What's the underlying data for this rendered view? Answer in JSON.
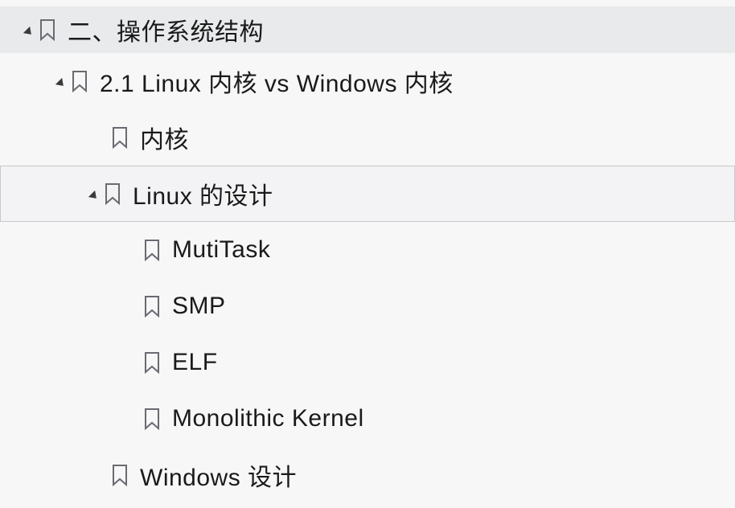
{
  "tree": {
    "lvl0": {
      "label": "二、操作系统结构"
    },
    "lvl1": {
      "label": "2.1 Linux 内核 vs Windows 内核"
    },
    "lvl2a": {
      "label": "内核"
    },
    "lvl2b": {
      "label": "Linux 的设计"
    },
    "lvl3a": {
      "label": "MutiTask"
    },
    "lvl3b": {
      "label": "SMP"
    },
    "lvl3c": {
      "label": "ELF"
    },
    "lvl3d": {
      "label": "Monolithic Kernel"
    },
    "lvl2c": {
      "label": "Windows 设计"
    }
  }
}
